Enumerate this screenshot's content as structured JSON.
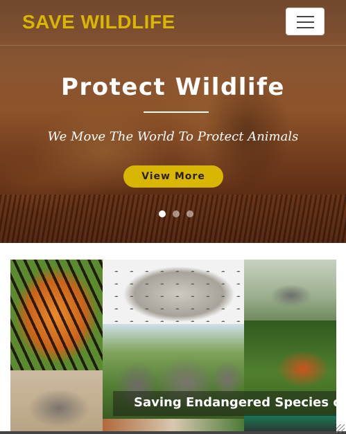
{
  "header": {
    "brand": "SAVE WILDLIFE",
    "brand_color": "#d9b700",
    "menu_icon": "hamburger-icon"
  },
  "hero": {
    "title": "Protect Wildlife",
    "subtitle": "We Move The World To Protect Animals",
    "cta_label": "View More",
    "cta_color": "#d9b700",
    "slides_total": 3,
    "active_slide": 1
  },
  "gallery": {
    "caption": "Saving Endangered Species of"
  }
}
